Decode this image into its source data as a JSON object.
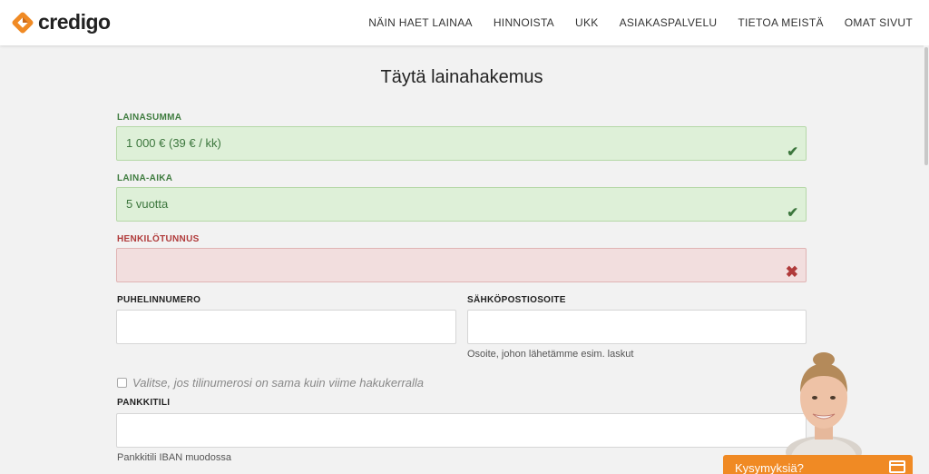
{
  "brand": {
    "name": "credigo",
    "accent": "#f08a24"
  },
  "nav": [
    {
      "label": "NÄIN HAET LAINAA"
    },
    {
      "label": "HINNOISTA"
    },
    {
      "label": "UKK"
    },
    {
      "label": "ASIAKASPALVELU"
    },
    {
      "label": "TIETOA MEISTÄ"
    },
    {
      "label": "OMAT SIVUT"
    }
  ],
  "form": {
    "title": "Täytä lainahakemus",
    "loan_amount": {
      "label": "LAINASUMMA",
      "value": "1 000 € (39 € / kk)",
      "status": "valid"
    },
    "loan_term": {
      "label": "LAINA-AIKA",
      "value": "5 vuotta",
      "status": "valid"
    },
    "ssn": {
      "label": "HENKILÖTUNNUS",
      "value": "",
      "status": "invalid"
    },
    "phone": {
      "label": "PUHELINNUMERO",
      "value": ""
    },
    "email": {
      "label": "SÄHKÖPOSTIOSOITE",
      "value": "",
      "help": "Osoite, johon lähetämme esim. laskut"
    },
    "same_account": {
      "label": "Valitse, jos tilinumerosi on sama kuin viime hakukerralla",
      "checked": false
    },
    "bank_account": {
      "label": "PANKKITILI",
      "value": "",
      "help": "Pankkitili IBAN muodossa"
    }
  },
  "chat": {
    "label": "Kysymyksiä?",
    "icon": "chat-window-icon"
  },
  "colors": {
    "valid_bg": "#def0d8",
    "valid_text": "#3c763d",
    "invalid_bg": "#f2dede",
    "invalid_text": "#b03a3a"
  }
}
